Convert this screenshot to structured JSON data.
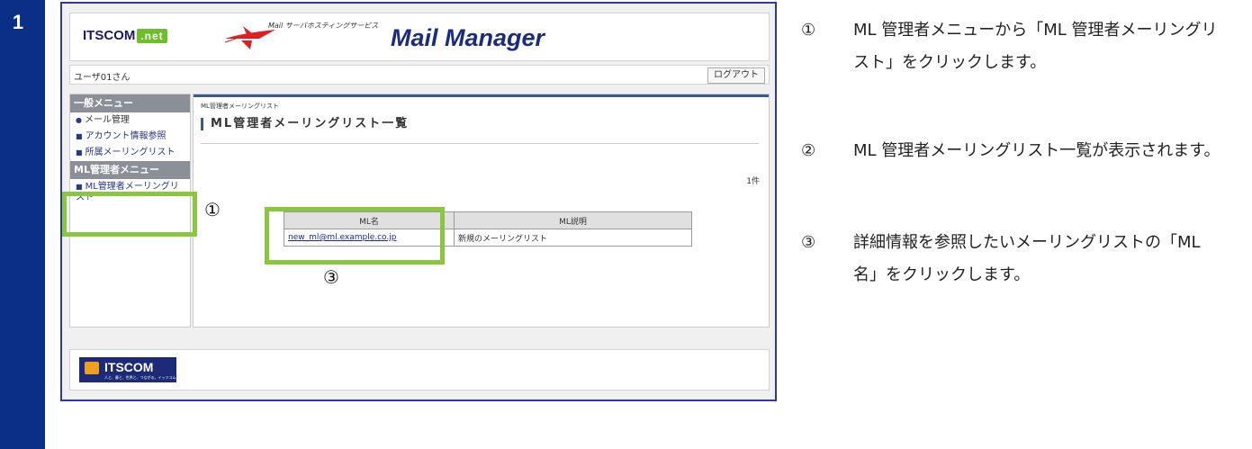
{
  "step": {
    "number": "1"
  },
  "colors": {
    "step_bar": "#0b2f86",
    "highlight": "#8cc63f",
    "title": "#1b2c7e"
  },
  "header": {
    "brand": "ITSCOM",
    "brand_net": ".net",
    "service_sub": "Mail サーバホスティングサービス",
    "service_title": "Mail Manager",
    "icon": "airplane-logo"
  },
  "userbar": {
    "username": "ユーザ01さん",
    "logout_label": "ログアウト"
  },
  "sidebar": {
    "general_heading": "一般メニュー",
    "mail_admin": "メール管理",
    "account_info": "アカウント情報参照",
    "member_ml": "所属メーリングリスト",
    "ml_admin_heading": "ML管理者メニュー",
    "ml_admin_list": "ML管理者メーリングリスト"
  },
  "main": {
    "breadcrumb": "ML管理者メーリングリスト",
    "title": "ML管理者メーリングリスト一覧",
    "count": "1件",
    "table": {
      "headers": [
        "ML名",
        "ML説明"
      ],
      "rows": [
        {
          "name": "new_ml@ml.example.co.jp",
          "description": "新規のメーリングリスト"
        }
      ]
    }
  },
  "footer": {
    "logo": "ITSCOM",
    "tagline": "人と、暮と、世界と、つながる。イッツコム"
  },
  "markers": {
    "m1": "①",
    "m3": "③"
  },
  "instructions": [
    {
      "num": "①",
      "text": "ML 管理者メニューから「ML 管理者メーリングリスト」をクリックします。"
    },
    {
      "num": "②",
      "text": "ML 管理者メーリングリスト一覧が表示されます。"
    },
    {
      "num": "③",
      "text": "詳細情報を参照したいメーリングリストの「ML 名」をクリックします。"
    }
  ]
}
